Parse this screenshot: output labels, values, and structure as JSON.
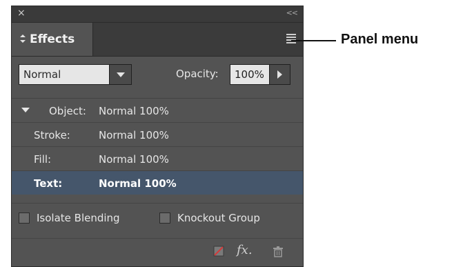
{
  "panel": {
    "close_glyph": "×",
    "collapse_glyph": "<<",
    "tab": {
      "label": "Effects",
      "icon": "updown-arrows-icon"
    },
    "menu_icon": "hamburger-icon"
  },
  "controls": {
    "blend_mode": "Normal",
    "opacity_label": "Opacity:",
    "opacity_value": "100%"
  },
  "rows": [
    {
      "label": "Object:",
      "value": "Normal 100%",
      "expanded": true,
      "selected": false
    },
    {
      "label": "Stroke:",
      "value": "Normal 100%",
      "selected": false
    },
    {
      "label": "Fill:",
      "value": "Normal 100%",
      "selected": false
    },
    {
      "label": "Text:",
      "value": "Normal 100%",
      "selected": true
    }
  ],
  "checkboxes": {
    "isolate_blending": {
      "label": "Isolate Blending",
      "checked": false
    },
    "knockout_group": {
      "label": "Knockout Group",
      "checked": false
    }
  },
  "footer": {
    "icons": [
      "clear-effects-icon",
      "fx-icon",
      "trash-icon"
    ],
    "fx_label": "fx."
  },
  "annotation": {
    "label": "Panel menu"
  },
  "colors": {
    "panel_bg": "#535353",
    "selection": "#45566b",
    "text": "#e6e6e6",
    "field_bg": "#e6e6e6"
  }
}
